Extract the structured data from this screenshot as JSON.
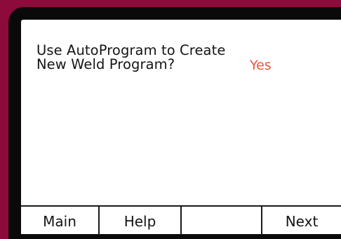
{
  "screen": {
    "prompt_lines": [
      "Use AutoProgram to Create",
      "New Weld Program?"
    ],
    "answer": "Yes"
  },
  "softkeys": [
    "Main",
    "Help",
    "",
    "Next"
  ],
  "colors": {
    "frame": "#8c0b3a",
    "bezel": "#0a0a0a",
    "screen_background": "#ffffff",
    "answer_text": "#f0553d"
  }
}
